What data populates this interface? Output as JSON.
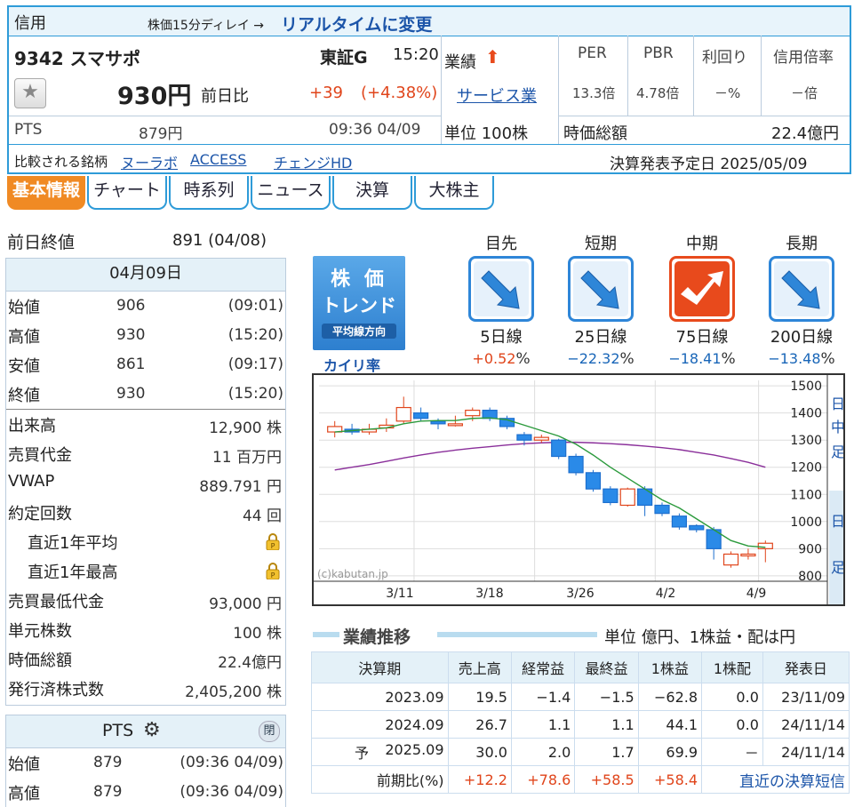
{
  "header": {
    "margin_label": "信用",
    "delay_text": "株価15分ディレイ →",
    "realtime_link": "リアルタイムに変更",
    "code_name": "9342 スマサポ",
    "market": "東証G",
    "time": "15:20",
    "price": "930円",
    "change_label": "前日比",
    "change": "+39",
    "change_pct": "(+4.38%)",
    "pts_label": "PTS",
    "pts_price": "879円",
    "pts_time": "09:36 04/09",
    "results_label": "業績",
    "sector_link": "サービス業",
    "unit_label": "単位 100株",
    "per_label": "PER",
    "pbr_label": "PBR",
    "yield_label": "利回り",
    "margin_ratio_label": "信用倍率",
    "per_value": "13.3倍",
    "pbr_value": "4.78倍",
    "yield_value": "－%",
    "margin_ratio_value": "－倍",
    "mcap_label": "時価総額",
    "mcap_value": "22.4億円",
    "compare_label": "比較される銘柄",
    "compare_links": [
      "ヌーラボ",
      "ACCESS",
      "チェンジHD"
    ],
    "earnings_date_label": "決算発表予定日 2025/05/09"
  },
  "tabs": [
    "基本情報",
    "チャート",
    "時系列",
    "ニュース",
    "決算",
    "大株主"
  ],
  "left": {
    "prev_close_label": "前日終値",
    "prev_close_value": "891 (04/08)",
    "date_header": "04月09日",
    "ohlc": [
      {
        "label": "始値",
        "value": "906",
        "time": "(09:01)"
      },
      {
        "label": "高値",
        "value": "930",
        "time": "(15:20)"
      },
      {
        "label": "安値",
        "value": "861",
        "time": "(09:17)"
      },
      {
        "label": "終値",
        "value": "930",
        "time": "(15:20)"
      }
    ],
    "stats": [
      {
        "label": "出来高",
        "value": "12,900 株"
      },
      {
        "label": "売買代金",
        "value": "11 百万円"
      },
      {
        "label": "VWAP",
        "value": "889.791 円"
      },
      {
        "label": "約定回数",
        "value": "44 回"
      }
    ],
    "locked": [
      {
        "label": "直近1年平均"
      },
      {
        "label": "直近1年最高"
      }
    ],
    "stats2": [
      {
        "label": "売買最低代金",
        "value": "93,000 円"
      },
      {
        "label": "単元株数",
        "value": "100 株"
      },
      {
        "label": "時価総額",
        "value": "22.4億円"
      },
      {
        "label": "発行済株式数",
        "value": "2,405,200 株"
      }
    ],
    "pts_header": "PTS",
    "pts_close_btn": "閉",
    "pts_rows": [
      {
        "label": "始値",
        "value": "879",
        "time": "(09:36 04/09)"
      },
      {
        "label": "高値",
        "value": "879",
        "time": "(09:36 04/09)"
      }
    ]
  },
  "trend": {
    "badge_line1": "株 価",
    "badge_line2": "トレンド",
    "badge_line3": "平均線方向",
    "kairi_label": "カイリ率",
    "items": [
      {
        "term": "目先",
        "line": "5日線",
        "pct": "+0.52",
        "dir": "down",
        "color": "#2e86d8"
      },
      {
        "term": "短期",
        "line": "25日線",
        "pct": "−22.32",
        "dir": "down",
        "color": "#2e86d8"
      },
      {
        "term": "中期",
        "line": "75日線",
        "pct": "−18.41",
        "dir": "up",
        "color": "#e84a1c"
      },
      {
        "term": "長期",
        "line": "200日線",
        "pct": "−13.48",
        "dir": "down",
        "color": "#2e86d8"
      }
    ],
    "pct_unit": "%"
  },
  "chart_data": {
    "type": "candlestick",
    "watermark": "(c)kabutan.jp",
    "yticks": [
      1500,
      1400,
      1300,
      1200,
      1100,
      1000,
      900,
      800
    ],
    "ylim": [
      780,
      1520
    ],
    "xticks": [
      "3/11",
      "3/18",
      "3/26",
      "4/2",
      "4/9"
    ],
    "side_labels": [
      "日",
      "中",
      "足",
      "日",
      "足"
    ],
    "candles": [
      {
        "o": 1330,
        "c": 1350,
        "h": 1370,
        "l": 1310
      },
      {
        "o": 1340,
        "c": 1330,
        "h": 1360,
        "l": 1320
      },
      {
        "o": 1330,
        "c": 1340,
        "h": 1360,
        "l": 1320
      },
      {
        "o": 1345,
        "c": 1355,
        "h": 1380,
        "l": 1330
      },
      {
        "o": 1370,
        "c": 1420,
        "h": 1460,
        "l": 1360
      },
      {
        "o": 1400,
        "c": 1380,
        "h": 1420,
        "l": 1370
      },
      {
        "o": 1370,
        "c": 1360,
        "h": 1380,
        "l": 1340
      },
      {
        "o": 1360,
        "c": 1360,
        "h": 1390,
        "l": 1350
      },
      {
        "o": 1390,
        "c": 1410,
        "h": 1420,
        "l": 1370
      },
      {
        "o": 1410,
        "c": 1380,
        "h": 1420,
        "l": 1370
      },
      {
        "o": 1380,
        "c": 1350,
        "h": 1390,
        "l": 1340
      },
      {
        "o": 1320,
        "c": 1300,
        "h": 1330,
        "l": 1280
      },
      {
        "o": 1300,
        "c": 1310,
        "h": 1320,
        "l": 1290
      },
      {
        "o": 1300,
        "c": 1240,
        "h": 1305,
        "l": 1230
      },
      {
        "o": 1240,
        "c": 1180,
        "h": 1250,
        "l": 1170
      },
      {
        "o": 1180,
        "c": 1120,
        "h": 1190,
        "l": 1110
      },
      {
        "o": 1120,
        "c": 1070,
        "h": 1130,
        "l": 1060
      },
      {
        "o": 1060,
        "c": 1120,
        "h": 1125,
        "l": 1055
      },
      {
        "o": 1120,
        "c": 1060,
        "h": 1130,
        "l": 1020
      },
      {
        "o": 1060,
        "c": 1030,
        "h": 1070,
        "l": 1020
      },
      {
        "o": 1020,
        "c": 980,
        "h": 1030,
        "l": 970
      },
      {
        "o": 985,
        "c": 970,
        "h": 990,
        "l": 960
      },
      {
        "o": 970,
        "c": 900,
        "h": 980,
        "l": 860
      },
      {
        "o": 840,
        "c": 880,
        "h": 890,
        "l": 830
      },
      {
        "o": 880,
        "c": 880,
        "h": 900,
        "l": 860
      },
      {
        "o": 900,
        "c": 920,
        "h": 930,
        "l": 850
      }
    ],
    "ma_short": [
      1330,
      1335,
      1340,
      1345,
      1360,
      1370,
      1372,
      1372,
      1380,
      1382,
      1375,
      1355,
      1335,
      1315,
      1285,
      1245,
      1200,
      1160,
      1120,
      1080,
      1050,
      1010,
      970,
      930,
      910,
      905
    ],
    "ma_long": [
      1190,
      1200,
      1210,
      1222,
      1234,
      1245,
      1255,
      1263,
      1270,
      1276,
      1282,
      1287,
      1290,
      1292,
      1292,
      1290,
      1287,
      1283,
      1278,
      1272,
      1265,
      1255,
      1245,
      1232,
      1218,
      1200
    ]
  },
  "results": {
    "title": "業績推移",
    "unit_text": "単位 億円、1株益・配は円",
    "headers": [
      "決算期",
      "売上高",
      "経常益",
      "最終益",
      "1株益",
      "1株配",
      "発表日"
    ],
    "rows": [
      {
        "cells": [
          "2023.09",
          "19.5",
          "−1.4",
          "−1.5",
          "−62.8",
          "0.0",
          "23/11/09"
        ],
        "prefix": ""
      },
      {
        "cells": [
          "2024.09",
          "26.7",
          "1.1",
          "1.1",
          "44.1",
          "0.0",
          "24/11/14"
        ],
        "prefix": ""
      },
      {
        "cells": [
          "2025.09",
          "30.0",
          "2.0",
          "1.7",
          "69.9",
          "－",
          "24/11/14"
        ],
        "prefix": "予"
      }
    ],
    "yoy_label": "前期比(%)",
    "yoy": [
      "+12.2",
      "+78.6",
      "+58.5",
      "+58.4"
    ],
    "latest_link": "直近の決算短信"
  }
}
